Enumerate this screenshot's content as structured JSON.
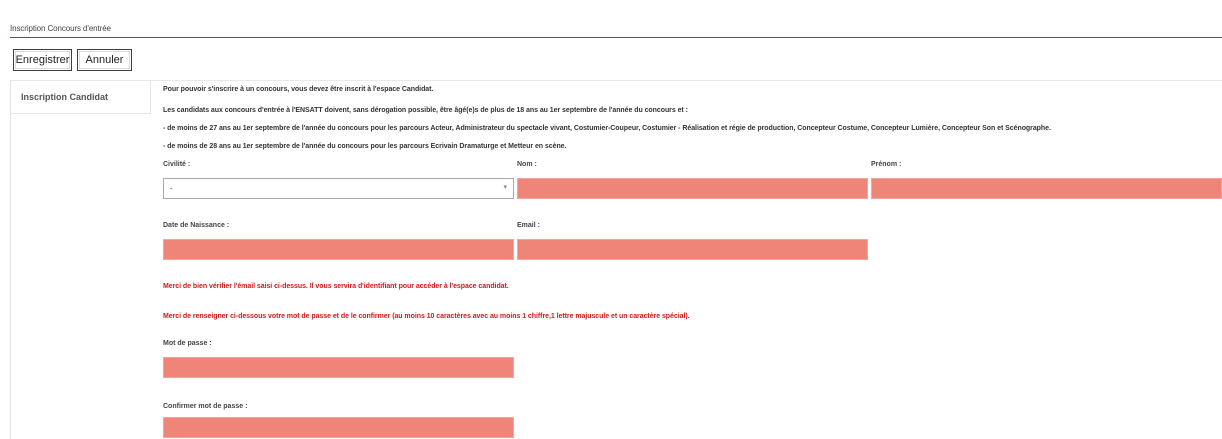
{
  "header": {
    "title": "Inscription Concours d'entrée"
  },
  "toolbar": {
    "save_label": "Enregistrer",
    "cancel_label": "Annuler"
  },
  "sidebar": {
    "items": [
      {
        "label": "Inscription Candidat"
      }
    ]
  },
  "intro": {
    "line1": "Pour pouvoir s'inscrire à un concours, vous devez être inscrit à l'espace Candidat.",
    "line2": "Les candidats aux concours d'entrée à l'ENSATT doivent, sans dérogation possible, être âgé(e)s de plus de 18 ans au 1er septembre de l'année du concours et :",
    "line3": "- de moins de 27 ans au 1er septembre de l'année du concours pour les parcours Acteur, Administrateur du spectacle vivant, Costumier-Coupeur, Costumier - Réalisation et régie de production, Concepteur Costume, Concepteur Lumière, Concepteur Son et Scénographe.",
    "line4": "- de moins de 28 ans au 1er septembre de l'année du concours pour les parcours Ecrivain Dramaturge et Metteur en scène."
  },
  "form": {
    "civilite": {
      "label": "Civilité :",
      "value": "-"
    },
    "nom": {
      "label": "Nom :",
      "value": ""
    },
    "prenom": {
      "label": "Prénom :",
      "value": ""
    },
    "date_naissance": {
      "label": "Date de Naissance :",
      "value": ""
    },
    "email": {
      "label": "Email :",
      "value": ""
    },
    "email_notice": "Merci de bien vérifier l'émail saisi ci-dessus. Il vous servira d'identifiant pour accéder à l'espace candidat.",
    "password_notice": "Merci de renseigner ci-dessous votre mot de passe et de le confirmer (au moins 10 caractères avec au moins 1 chiffre,1 lettre majuscule et un caractère spécial).",
    "mot_de_passe": {
      "label": "Mot de passe :",
      "value": ""
    },
    "confirmer": {
      "label": "Confirmer mot de passe :",
      "value": ""
    }
  },
  "colors": {
    "invalid_field": "#ef8579",
    "notice_red": "#d0191b",
    "header_rule": "#3a5f8f"
  },
  "icons": {
    "select_arrow": "chevron-down-icon"
  }
}
